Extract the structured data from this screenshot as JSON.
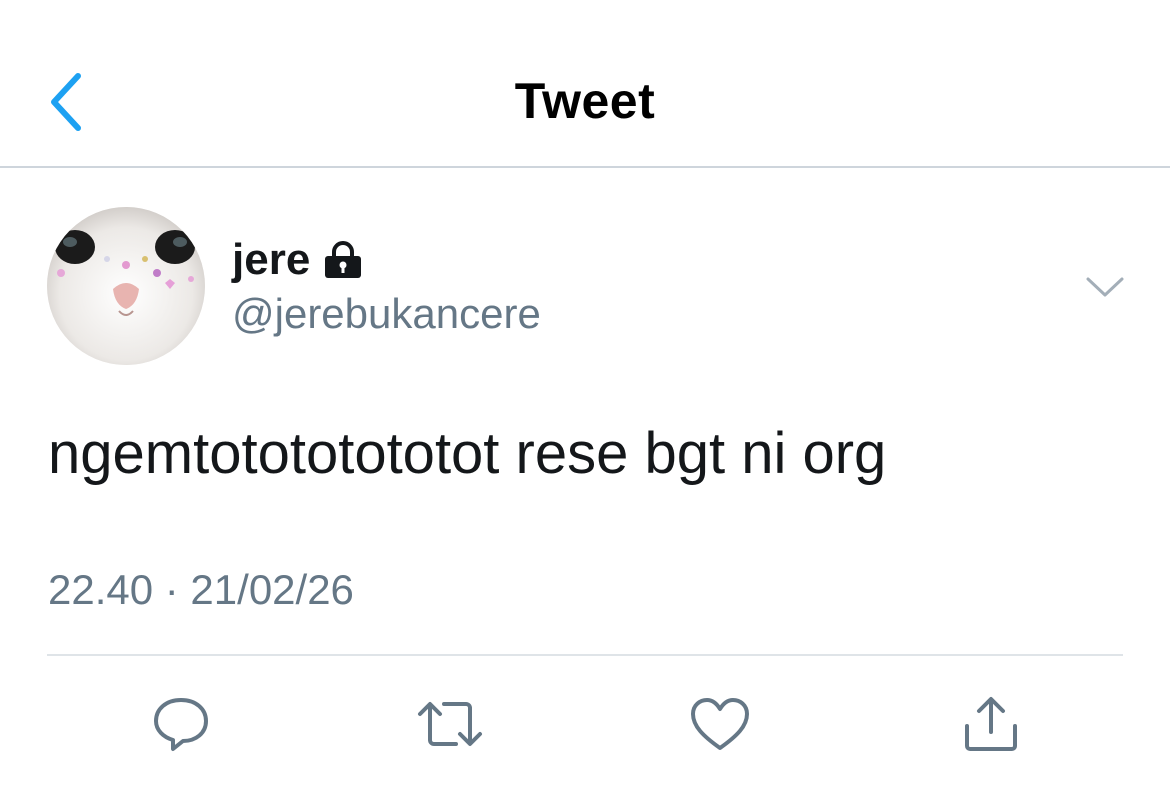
{
  "header": {
    "title": "Tweet",
    "back_icon": "chevron-left-icon",
    "accent_color": "#1da1f2"
  },
  "tweet": {
    "author": {
      "name": "jere",
      "handle": "@jerebukancere",
      "protected": true,
      "avatar": "cat-avatar"
    },
    "text": "ngemtotototototot rese bgt ni org",
    "meta": "22.40 · 21/02/26",
    "more_icon": "chevron-down-icon"
  },
  "actions": [
    {
      "name": "reply",
      "icon": "reply-icon"
    },
    {
      "name": "retweet",
      "icon": "retweet-icon"
    },
    {
      "name": "like",
      "icon": "heart-icon"
    },
    {
      "name": "share",
      "icon": "share-icon"
    }
  ],
  "colors": {
    "text": "#14171a",
    "secondary": "#657786",
    "icon": "#657786",
    "divider": "#ced5dc"
  }
}
